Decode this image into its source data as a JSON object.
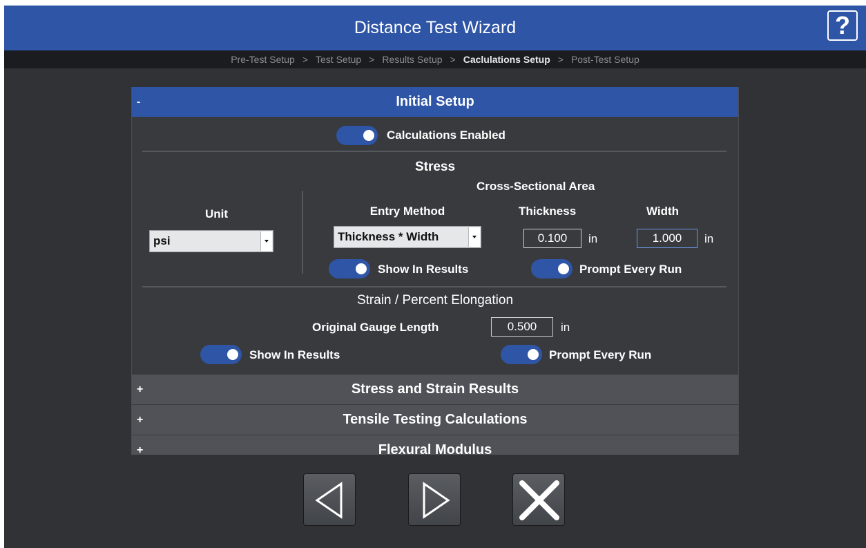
{
  "window": {
    "title": "Distance Test Wizard",
    "help_label": "?"
  },
  "breadcrumb": [
    {
      "label": "Pre-Test Setup",
      "active": false
    },
    {
      "label": "Test Setup",
      "active": false
    },
    {
      "label": "Results Setup",
      "active": false
    },
    {
      "label": "Caclulations Setup",
      "active": true
    },
    {
      "label": "Post-Test Setup",
      "active": false
    }
  ],
  "breadcrumb_separator": ">",
  "initial_setup": {
    "sign": "-",
    "title": "Initial Setup",
    "calculations_enabled": {
      "label": "Calculations Enabled",
      "on": true
    },
    "stress": {
      "title": "Stress",
      "unit_label": "Unit",
      "unit_value": "psi",
      "cross_section_title": "Cross-Sectional Area",
      "entry_method_label": "Entry Method",
      "entry_method_value": "Thickness * Width",
      "thickness_label": "Thickness",
      "thickness_value": "0.100",
      "thickness_unit": "in",
      "width_label": "Width",
      "width_value": "1.000",
      "width_unit": "in",
      "show_in_results": {
        "label": "Show In Results",
        "on": true
      },
      "prompt_every_run": {
        "label": "Prompt Every Run",
        "on": true
      }
    },
    "strain": {
      "title": "Strain / Percent Elongation",
      "gauge_label": "Original Gauge Length",
      "gauge_value": "0.500",
      "gauge_unit": "in",
      "show_in_results": {
        "label": "Show In Results",
        "on": true
      },
      "prompt_every_run": {
        "label": "Prompt Every Run",
        "on": true
      }
    }
  },
  "collapsed_sections": [
    {
      "sign": "+",
      "title": "Stress and Strain Results"
    },
    {
      "sign": "+",
      "title": "Tensile Testing Calculations"
    },
    {
      "sign": "+",
      "title": "Flexural Modulus"
    }
  ],
  "nav": {
    "back_icon": "triangle-left-icon",
    "next_icon": "triangle-right-icon",
    "cancel_icon": "close-x-icon"
  },
  "colors": {
    "accent": "#2f55a6",
    "background": "#303236",
    "panel": "#383a3e",
    "collapsed_header": "#505257"
  }
}
